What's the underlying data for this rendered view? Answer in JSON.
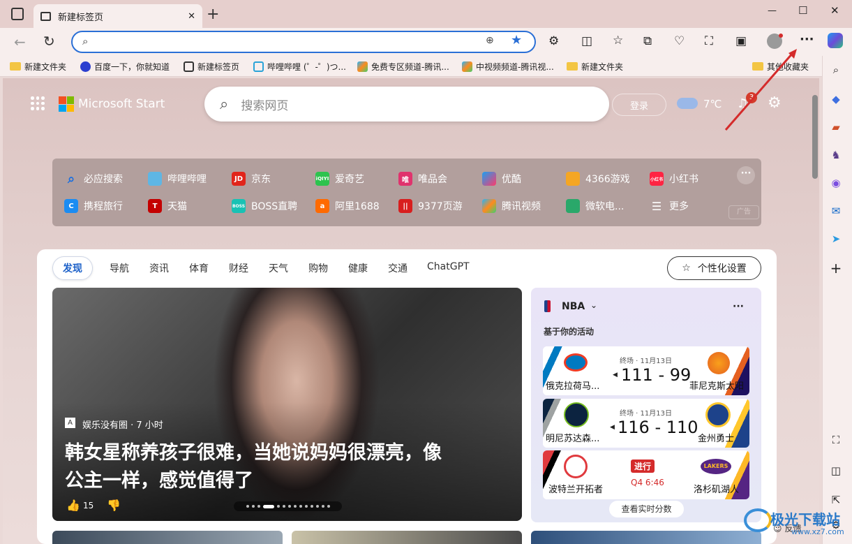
{
  "tab": {
    "title": "新建标签页",
    "close": "✕",
    "new": "+"
  },
  "window": {
    "min": "—",
    "max": "☐",
    "close": "✕"
  },
  "address": {
    "value": "",
    "placeholder": ""
  },
  "bookmarks": [
    {
      "label": "新建文件夹",
      "icon": "folder-icon"
    },
    {
      "label": "百度一下，你就知道",
      "icon": "baidu-icon"
    },
    {
      "label": "新建标签页",
      "icon": "tab-icon"
    },
    {
      "label": "哔哩哔哩 (゜-゜)つ...",
      "icon": "bilibili-icon"
    },
    {
      "label": "免费专区频道-腾讯...",
      "icon": "tencent-video-icon"
    },
    {
      "label": "中视频频道-腾讯视...",
      "icon": "tencent-video-icon"
    },
    {
      "label": "新建文件夹",
      "icon": "folder-icon"
    }
  ],
  "bookmarks_other": "其他收藏夹",
  "ms": {
    "brand": "Microsoft Start",
    "search_placeholder": "搜索网页",
    "login": "登录",
    "temp": "7℃",
    "notif_count": "3"
  },
  "quick": {
    "row1": [
      "必应搜索",
      "哔哩哔哩",
      "京东",
      "爱奇艺",
      "唯品会",
      "优酷",
      "4366游戏",
      "小红书"
    ],
    "row2": [
      "携程旅行",
      "天猫",
      "BOSS直聘",
      "阿里1688",
      "9377页游",
      "腾讯视频",
      "微软电...",
      "更多"
    ],
    "ad": "广告"
  },
  "feed": {
    "tabs": [
      "发现",
      "导航",
      "资讯",
      "体育",
      "财经",
      "天气",
      "购物",
      "健康",
      "交通",
      "ChatGPT"
    ],
    "personalize": "个性化设置",
    "hero": {
      "source": "娱乐没有圈 · 7 小时",
      "headline_1": "韩女星称养孩子很难，当她说妈妈很漂亮，像",
      "headline_2": "公主一样，感觉值得了",
      "likes": "15"
    }
  },
  "nba": {
    "title": "NBA",
    "subtitle": "基于你的活动",
    "more": "···",
    "games": [
      {
        "status": "终场 · 11月13日",
        "score": "111 - 99",
        "home": "俄克拉荷马...",
        "away": "菲尼克斯太阳",
        "live": false
      },
      {
        "status": "终场 · 11月13日",
        "score": "116 - 110",
        "home": "明尼苏达森...",
        "away": "金州勇士",
        "live": false
      },
      {
        "status": "进行",
        "score": "Q4 6:46",
        "home": "波特兰开拓者",
        "away": "洛杉矶湖人",
        "live": true
      }
    ],
    "live_btn": "查看实时分数"
  },
  "feedback": "反馈",
  "watermark": "极光下载站",
  "watermark_url": "www.xz7.com",
  "colors": {
    "accent": "#2a6fd6",
    "arrow": "#d42b2b",
    "live": "#d42b2b"
  }
}
